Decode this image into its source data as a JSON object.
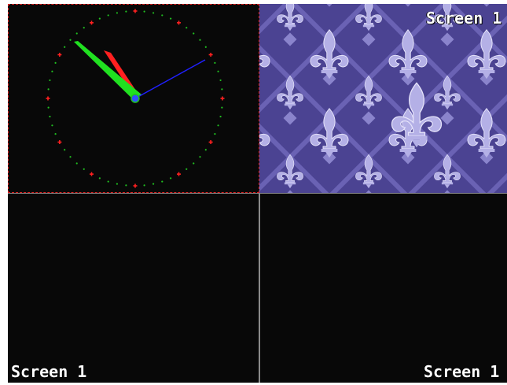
{
  "screens": {
    "top_right": {
      "label": "Screen 1"
    },
    "bottom_left": {
      "label": "Screen 1"
    },
    "bottom_right": {
      "label": "Screen 1"
    }
  },
  "clock": {
    "hour_hand_color": "#ff2020",
    "minute_hand_color": "#20e020",
    "second_hand_color": "#2020ff",
    "hour_marker_color": "#ff2020",
    "minute_dot_color": "#20c020",
    "hub_color": "#3050ff"
  },
  "pattern": {
    "background_color": "#4b4392",
    "motif_color": "#b4b0e6",
    "icon": "fleur-de-lis-icon"
  },
  "colors": {
    "pane_background": "#080808",
    "active_border": "#e02020",
    "divider": "#8a8a8a"
  }
}
